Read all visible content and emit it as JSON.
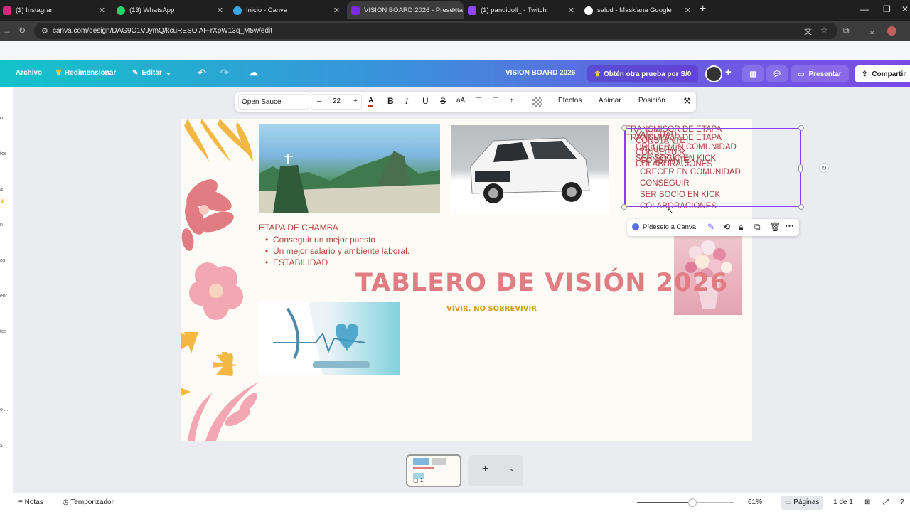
{
  "browser": {
    "tabs": [
      {
        "title": "(1) Instagram",
        "color": "#d6297c"
      },
      {
        "title": "(13) WhatsApp",
        "color": "#25d366"
      },
      {
        "title": "Inicio - Canva",
        "color": "#3aa7e6"
      },
      {
        "title": "VISION BOARD 2026 - Presenta",
        "color": "#7d2ae8"
      },
      {
        "title": "(1) pandidoll_ - Twitch",
        "color": "#9146ff"
      },
      {
        "title": "salud - Mask'ana Google",
        "color": "#ffffff"
      }
    ],
    "url": "canva.com/design/DAG9O1VJymQ/kcuRESOiAF-rXpW13q_M5w/edit"
  },
  "header": {
    "archivo": "Archivo",
    "redimensionar": "Redimensionar",
    "editar": "Editar",
    "design_title": "VISION BOARD 2026",
    "trial": "Obtén otra prueba por S/0",
    "presentar": "Presentar",
    "compartir": "Compartir"
  },
  "toolbar": {
    "font": "Open Sauce",
    "size": "22",
    "minus": "–",
    "plus": "+",
    "efectos": "Efectos",
    "animar": "Animar",
    "posicion": "Posición"
  },
  "left_rail": [
    "o",
    "tos",
    "a",
    "n",
    "os",
    "ent...",
    "tos",
    "o ...",
    "s"
  ],
  "canvas": {
    "selected_text_lines": [
      "TRANSMISOR DE ETAPA",
      "VARIEDAD",
      "CONSTANTE",
      "CRECER EN COMUNIDAD",
      "CONSEGUIR",
      "SER SOCIO EN KICK",
      "COLABORACIONES"
    ],
    "context_label": "Pídeselo a Canva",
    "etapa_heading": "ETAPA DE CHAMBA",
    "etapa_items": [
      "Conseguir un mejor puesto",
      "Un mejor salario y ambiente laboral.",
      "ESTABILIDAD"
    ],
    "title": "TABLERO DE VISIÓN 2026",
    "subtitle": "VIVIR, NO SOBREVIVIR"
  },
  "pages": {
    "thumb_number": "1",
    "comments": "1"
  },
  "status": {
    "notas": "Notas",
    "temporizador": "Temporizador",
    "zoom_label": "61%",
    "zoom_level": 0.61,
    "paginas": "Páginas",
    "page_count": "1 de 1"
  }
}
